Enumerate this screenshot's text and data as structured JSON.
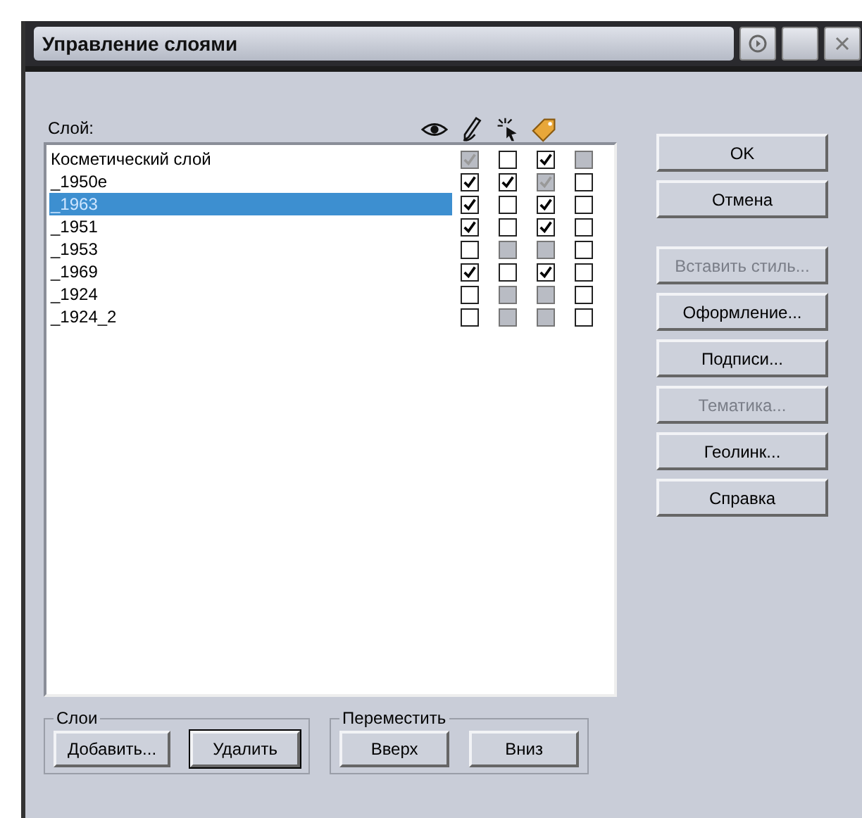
{
  "window": {
    "title": "Управление слоями"
  },
  "layers": {
    "label": "Слой:",
    "rows": [
      {
        "name": "Косметический слой",
        "selected": false,
        "flags": [
          {
            "checked": true,
            "disabled": true
          },
          {
            "checked": false,
            "disabled": false
          },
          {
            "checked": true,
            "disabled": false
          },
          {
            "checked": false,
            "disabled": true
          }
        ]
      },
      {
        "name": "_1950e",
        "selected": false,
        "flags": [
          {
            "checked": true,
            "disabled": false
          },
          {
            "checked": true,
            "disabled": false
          },
          {
            "checked": true,
            "disabled": true
          },
          {
            "checked": false,
            "disabled": false
          }
        ]
      },
      {
        "name": "_1963",
        "selected": true,
        "flags": [
          {
            "checked": true,
            "disabled": false
          },
          {
            "checked": false,
            "disabled": false
          },
          {
            "checked": true,
            "disabled": false
          },
          {
            "checked": false,
            "disabled": false
          }
        ]
      },
      {
        "name": "_1951",
        "selected": false,
        "flags": [
          {
            "checked": true,
            "disabled": false
          },
          {
            "checked": false,
            "disabled": false
          },
          {
            "checked": true,
            "disabled": false
          },
          {
            "checked": false,
            "disabled": false
          }
        ]
      },
      {
        "name": "_1953",
        "selected": false,
        "flags": [
          {
            "checked": false,
            "disabled": false
          },
          {
            "checked": false,
            "disabled": true
          },
          {
            "checked": false,
            "disabled": true
          },
          {
            "checked": false,
            "disabled": false
          }
        ]
      },
      {
        "name": "_1969",
        "selected": false,
        "flags": [
          {
            "checked": true,
            "disabled": false
          },
          {
            "checked": false,
            "disabled": false
          },
          {
            "checked": true,
            "disabled": false
          },
          {
            "checked": false,
            "disabled": false
          }
        ]
      },
      {
        "name": "_1924",
        "selected": false,
        "flags": [
          {
            "checked": false,
            "disabled": false
          },
          {
            "checked": false,
            "disabled": true
          },
          {
            "checked": false,
            "disabled": true
          },
          {
            "checked": false,
            "disabled": false
          }
        ]
      },
      {
        "name": "_1924_2",
        "selected": false,
        "flags": [
          {
            "checked": false,
            "disabled": false
          },
          {
            "checked": false,
            "disabled": true
          },
          {
            "checked": false,
            "disabled": true
          },
          {
            "checked": false,
            "disabled": false
          }
        ]
      }
    ]
  },
  "dialog_buttons": [
    {
      "label": "OK",
      "disabled": false
    },
    {
      "label": "Отмена",
      "disabled": false
    }
  ],
  "side_buttons": [
    {
      "label": "Вставить стиль...",
      "disabled": true
    },
    {
      "label": "Оформление...",
      "disabled": false
    },
    {
      "label": "Подписи...",
      "disabled": false
    },
    {
      "label": "Тематика...",
      "disabled": true
    },
    {
      "label": "Геолинк...",
      "disabled": false
    },
    {
      "label": "Справка",
      "disabled": false
    }
  ],
  "groups": [
    {
      "title": "Слои",
      "buttons": [
        {
          "label": "Добавить...",
          "focused": false
        },
        {
          "label": "Удалить",
          "focused": true
        }
      ]
    },
    {
      "title": "Переместить",
      "buttons": [
        {
          "label": "Вверх",
          "focused": false
        },
        {
          "label": "Вниз",
          "focused": false
        }
      ]
    }
  ]
}
